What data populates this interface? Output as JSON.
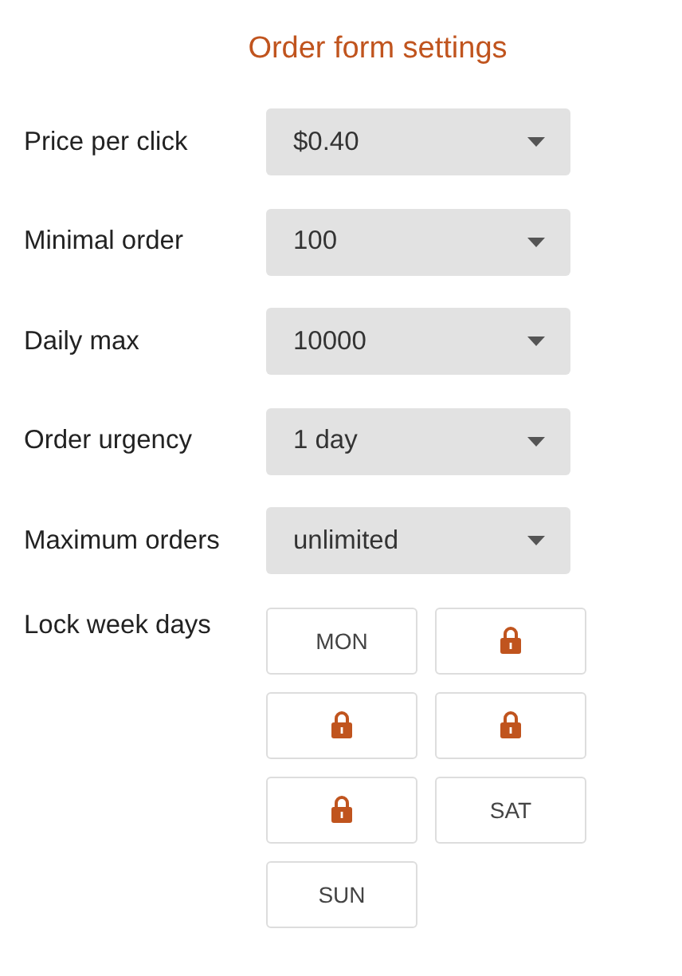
{
  "title": "Order form settings",
  "fields": [
    {
      "label": "Price per click",
      "value": "$0.40"
    },
    {
      "label": "Minimal order",
      "value": "100"
    },
    {
      "label": "Daily max",
      "value": "10000"
    },
    {
      "label": "Order urgency",
      "value": "1 day"
    },
    {
      "label": "Maximum orders",
      "value": "unlimited"
    }
  ],
  "week_days": {
    "label": "Lock week days",
    "days": [
      {
        "label": "MON",
        "locked": false
      },
      {
        "locked": true
      },
      {
        "locked": true
      },
      {
        "locked": true
      },
      {
        "locked": true
      },
      {
        "label": "SAT",
        "locked": false
      },
      {
        "label": "SUN",
        "locked": false
      }
    ]
  }
}
